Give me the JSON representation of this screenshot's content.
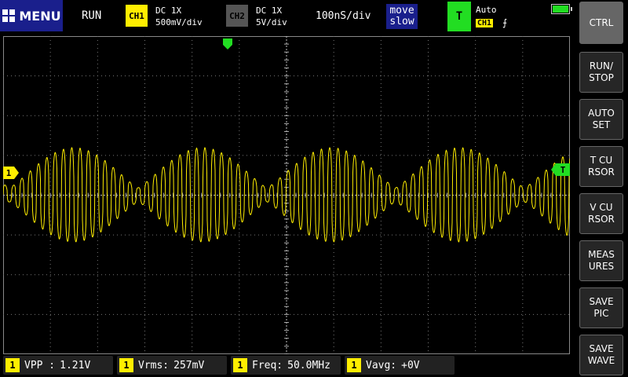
{
  "top_bar": {
    "menu_label": "MENU",
    "run_status": "RUN",
    "ch1": {
      "label": "CH1",
      "coupling": "DC  1X",
      "scale": "500mV/div"
    },
    "ch2": {
      "label": "CH2",
      "coupling": "DC  1X",
      "scale": "5V/div"
    },
    "timebase": "100nS/div",
    "speed": {
      "line1": "move",
      "line2": "slow"
    },
    "trigger": {
      "label": "T",
      "mode": "Auto",
      "source": "CH1",
      "edge": "⨍"
    }
  },
  "side_buttons": [
    {
      "id": "ctrl",
      "label": "CTRL"
    },
    {
      "id": "run-stop",
      "label": "RUN/\nSTOP"
    },
    {
      "id": "auto-set",
      "label": "AUTO\nSET"
    },
    {
      "id": "t-cursor",
      "label": "T CU\nRSOR"
    },
    {
      "id": "v-cursor",
      "label": "V CU\nRSOR"
    },
    {
      "id": "measures",
      "label": "MEAS\nURES"
    },
    {
      "id": "save-pic",
      "label": "SAVE\nPIC"
    },
    {
      "id": "save-wave",
      "label": "SAVE\nWAVE"
    }
  ],
  "markers": {
    "ch1_level": "1",
    "trigger_level": "T"
  },
  "measurements": [
    {
      "ch": "1",
      "name": "VPP :",
      "value": "1.21V"
    },
    {
      "ch": "1",
      "name": "Vrms:",
      "value": "257mV"
    },
    {
      "ch": "1",
      "name": "Freq:",
      "value": "50.0MHz"
    },
    {
      "ch": "1",
      "name": "Vavg:",
      "value": "+0V"
    }
  ],
  "colors": {
    "ch1": "#ffee00",
    "trigger": "#22dd22",
    "menu": "#1a1f8c"
  }
}
